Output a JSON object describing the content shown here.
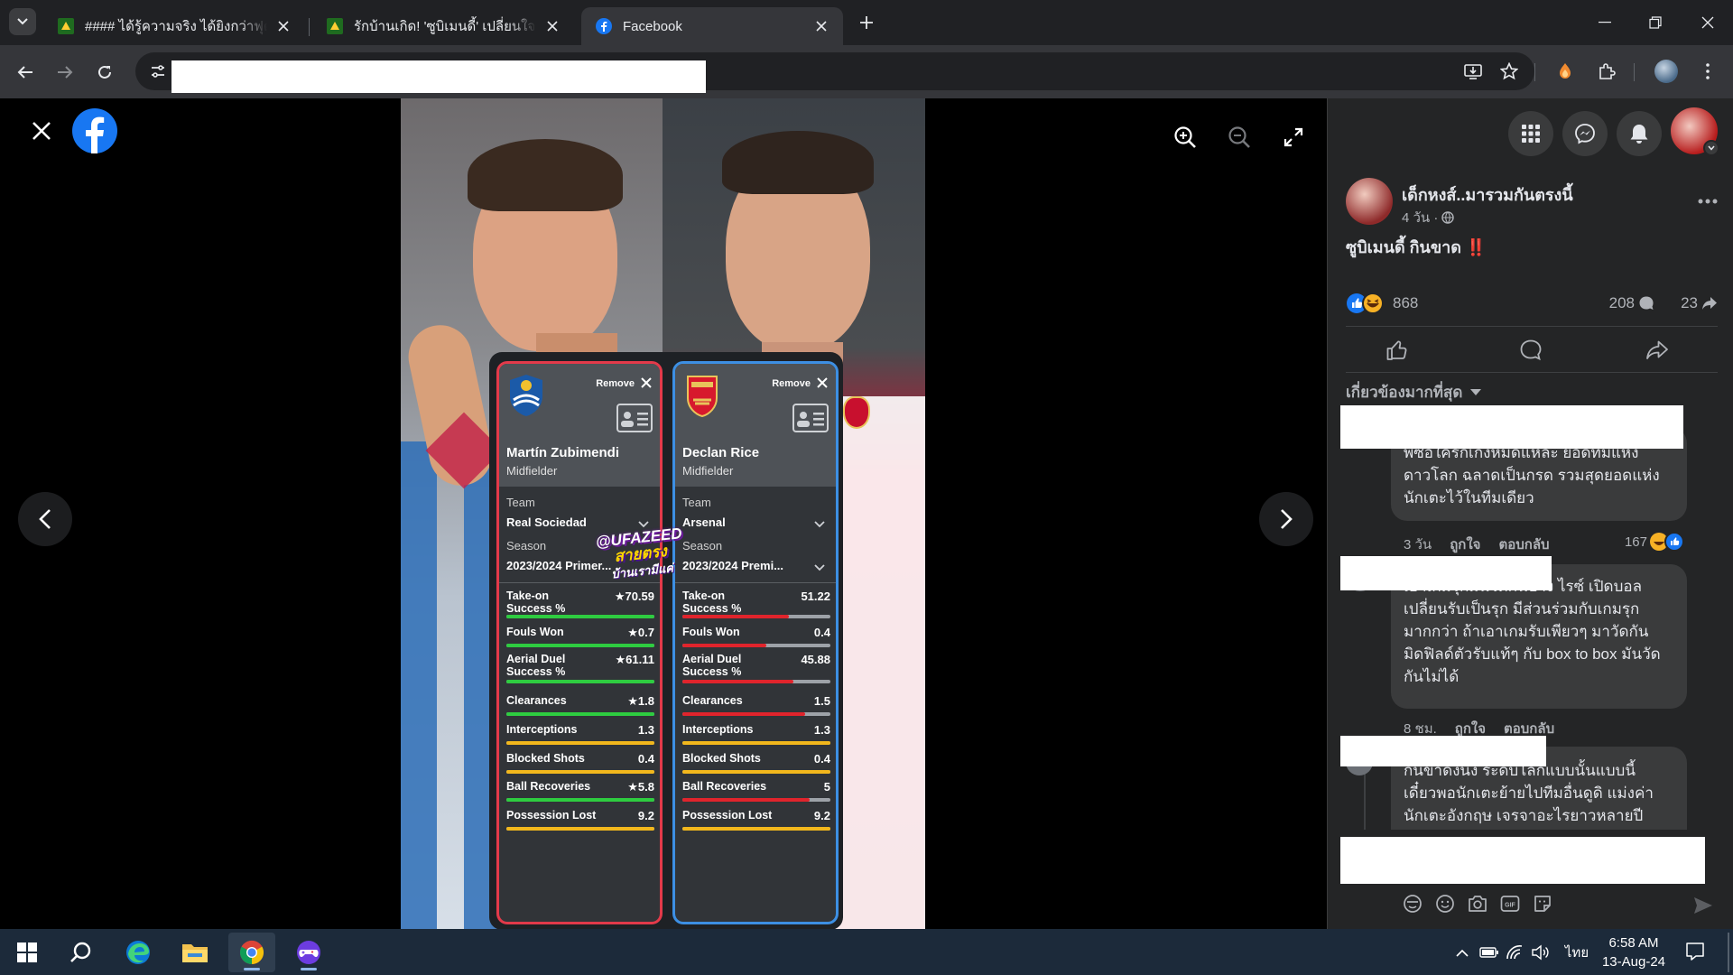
{
  "browser": {
    "tabs": [
      {
        "title": "#### ได้รู้ความจริง ได้ยิงกว่าฟุตบอลโลก",
        "favicon": "ufa-favicon",
        "active": false
      },
      {
        "title": "รักบ้านเกิด! 'ซูบิเมนดี้' เปลี่ยนใจปัดข้อเสนอ",
        "favicon": "ufa-favicon",
        "active": false
      },
      {
        "title": "Facebook",
        "favicon": "facebook-favicon",
        "active": true
      }
    ],
    "url": ""
  },
  "viewer": {
    "watermark": {
      "line1": "@UFAZEED",
      "line2": "สายตรง",
      "line3": "บ้านเรามีแค่"
    }
  },
  "cards": [
    {
      "remove_label": "Remove",
      "player": "Martín Zubimendi",
      "position": "Midfielder",
      "team_label": "Team",
      "team": "Real Sociedad",
      "season_label": "Season",
      "season": "2023/2024 Primer...",
      "accent": "#e33a4a",
      "stats": [
        {
          "name": "Take-on Success %",
          "value": "★70.59",
          "level": 1.0,
          "color": "#2ecc40"
        },
        {
          "name": "Fouls Won",
          "value": "★0.7",
          "level": 1.0,
          "color": "#2ecc40"
        },
        {
          "name": "Aerial Duel Success %",
          "value": "★61.11",
          "level": 1.0,
          "color": "#2ecc40"
        },
        {
          "name": "Clearances",
          "value": "★1.8",
          "level": 1.0,
          "color": "#2ecc40"
        },
        {
          "name": "Interceptions",
          "value": "1.3",
          "level": 1.0,
          "color": "#f2b71c"
        },
        {
          "name": "Blocked Shots",
          "value": "0.4",
          "level": 1.0,
          "color": "#f2b71c"
        },
        {
          "name": "Ball Recoveries",
          "value": "★5.8",
          "level": 1.0,
          "color": "#2ecc40"
        },
        {
          "name": "Possession Lost",
          "value": "9.2",
          "level": 1.0,
          "color": "#f2b71c"
        }
      ]
    },
    {
      "remove_label": "Remove",
      "player": "Declan Rice",
      "position": "Midfielder",
      "team_label": "Team",
      "team": "Arsenal",
      "season_label": "Season",
      "season": "2023/2024 Premi...",
      "accent": "#3d8fe3",
      "stats": [
        {
          "name": "Take-on Success %",
          "value": "51.22",
          "level": 0.72,
          "color": "#e0242c"
        },
        {
          "name": "Fouls Won",
          "value": "0.4",
          "level": 0.57,
          "color": "#e0242c"
        },
        {
          "name": "Aerial Duel Success %",
          "value": "45.88",
          "level": 0.75,
          "color": "#e0242c"
        },
        {
          "name": "Clearances",
          "value": "1.5",
          "level": 0.83,
          "color": "#e0242c"
        },
        {
          "name": "Interceptions",
          "value": "1.3",
          "level": 1.0,
          "color": "#f2b71c"
        },
        {
          "name": "Blocked Shots",
          "value": "0.4",
          "level": 1.0,
          "color": "#f2b71c"
        },
        {
          "name": "Ball Recoveries",
          "value": "5",
          "level": 0.86,
          "color": "#e0242c"
        },
        {
          "name": "Possession Lost",
          "value": "9.2",
          "level": 1.0,
          "color": "#f2b71c"
        }
      ]
    }
  ],
  "post": {
    "author": "เด็กหงส์..มารวมกันตรงนี้",
    "time": "4 วัน ·",
    "text": "ซูบิเมนดี้ กินขาด",
    "text_emoji": "‼️",
    "reactions": "868",
    "comments": "208",
    "shares": "23",
    "sort_label": "เกี่ยวข้องมากที่สุด"
  },
  "comments": [
    {
      "text_lines": [
        "พี่ซื้อใครก็เก่งหมดแหละ ยอดทีมแห่ง",
        "ดาวโลก ฉลาดเป็นกรด รวมสุดยอดแห่ง",
        "นักเตะไว้ในทีมเดียว"
      ],
      "time": "3 วัน",
      "like": "ถูกใจ",
      "reply": "ตอบกลับ",
      "reactions": "167"
    },
    {
      "text_lines": [
        "เอาเกมรุกมันวัดกันบ้าง ไรซ์ เปิดบอล",
        "เปลี่ยนรับเป็นรุก มีส่วนร่วมกับเกมรุก",
        "มากกว่า ถ้าเอาเกมรับเพียวๆ มาวัดกัน",
        "มิดฟิลด์ตัวรับแท้ๆ กับ box to box มันวัด",
        "กันไม่ได้"
      ],
      "time": "8 ชม.",
      "like": "ถูกใจ",
      "reply": "ตอบกลับ"
    },
    {
      "text_lines": [
        "กินขาดงั้นงี้ ระดับโลกแบบนั้นแบบนี้",
        "เดี๋ยวพอนักเตะย้ายไปทีมอื่นดูดิ แม่งค่า",
        "นักเตะอังกฤษ เจรจาอะไรยาวหลายปี"
      ]
    }
  ],
  "taskbar": {
    "time": "6:58 AM",
    "date": "13-Aug-24",
    "lang": "ไทย"
  }
}
